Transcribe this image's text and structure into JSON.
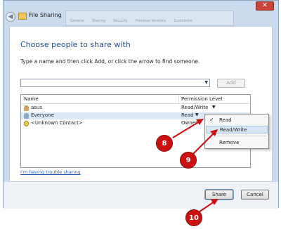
{
  "window": {
    "title": "File Sharing",
    "close_symbol": "✕"
  },
  "background_tabs": [
    "General",
    "Sharing",
    "Security",
    "Previous Versions",
    "Customize"
  ],
  "dialog": {
    "heading": "Choose people to share with",
    "instruction": "Type a name and then click Add, or click the arrow to find someone.",
    "name_input": {
      "value": "",
      "placeholder": ""
    },
    "add_button": "Add"
  },
  "list": {
    "columns": {
      "name": "Name",
      "permission": "Permission Level"
    },
    "rows": [
      {
        "name": "asus",
        "permission": "Read/Write",
        "icon": "user-icon"
      },
      {
        "name": "Everyone",
        "permission": "Read",
        "icon": "group-icon"
      },
      {
        "name": "<Unknown Contact>",
        "permission": "Owner",
        "icon": "unknown-contact-icon"
      }
    ]
  },
  "permission_menu": {
    "items": [
      {
        "label": "Read",
        "checked": true
      },
      {
        "label": "Read/Write",
        "checked": false
      },
      {
        "label": "Remove",
        "checked": false
      }
    ]
  },
  "trouble_link": "I'm having trouble sharing",
  "footer": {
    "share_button": "Share",
    "cancel_button": "Cancel"
  },
  "annotations": {
    "step_8": "8",
    "step_9": "9",
    "step_10": "10",
    "color": "#cc1010"
  },
  "icons": {
    "back": "back-arrow-icon",
    "app": "folder-share-icon",
    "dropdown": "chevron-down-icon",
    "check": "checkmark-icon"
  }
}
